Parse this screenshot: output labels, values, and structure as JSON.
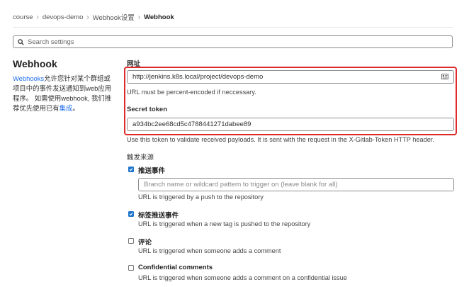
{
  "breadcrumb": [
    "course",
    "devops-demo",
    "Webhook设置",
    "Webhook"
  ],
  "search": {
    "placeholder": "Search settings"
  },
  "left": {
    "title": "Webhook",
    "desc_link": "Webhooks",
    "desc_text": "允许您针对某个群组或项目中的事件发送通知到web应用程序。 如需使用webhook, 我们推荐优先使用已有",
    "desc_link2": "集成",
    "desc_end": "。"
  },
  "form": {
    "url_label": "网址",
    "url_value": "http://jenkins.k8s.local/project/devops-demo",
    "url_help": "URL must be percent-encoded if neccessary.",
    "token_label": "Secret token",
    "token_value": "a934bc2ee68cd5c4788441271dabee89",
    "token_help": "Use this token to validate received payloads. It is sent with the request in the X-Gitlab-Token HTTP header.",
    "trigger_label": "触发来源",
    "push": {
      "label": "推送事件",
      "checked": true,
      "placeholder": "Branch name or wildcard pattern to trigger on (leave blank for all)",
      "help": "URL is triggered by a push to the repository"
    },
    "tag": {
      "label": "标签推送事件",
      "checked": true,
      "help": "URL is triggered when a new tag is pushed to the repository"
    },
    "comment": {
      "label": "评论",
      "checked": false,
      "help": "URL is triggered when someone adds a comment"
    },
    "confidential": {
      "label": "Confidential comments",
      "checked": false,
      "help": "URL is triggered when someone adds a comment on a confidential issue"
    }
  },
  "colors": {
    "accent": "#1f75cb",
    "highlight_border": "#dd2b2b",
    "link": "#1f6feb"
  }
}
